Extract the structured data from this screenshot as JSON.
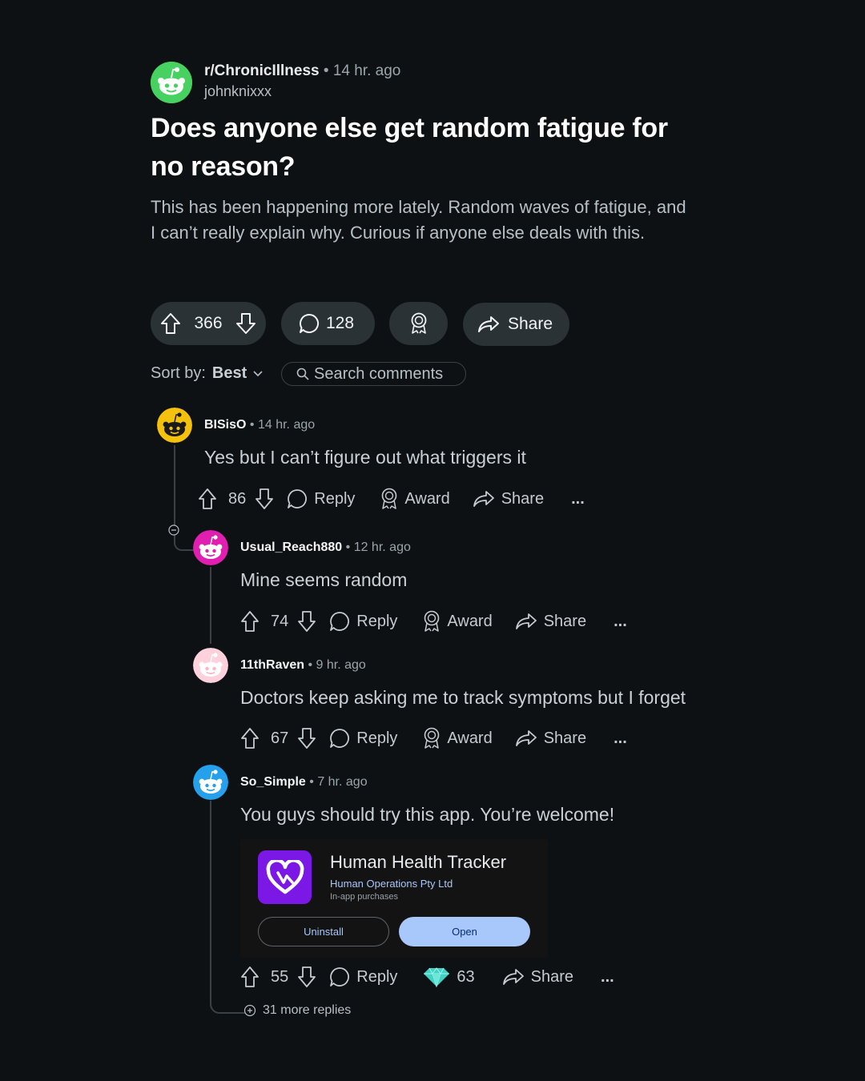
{
  "post": {
    "subreddit": "r/ChronicIllness",
    "separator": "•",
    "time": "14 hr. ago",
    "author": "johnknixxx",
    "title": "Does anyone else get random fatigue for no reason?",
    "body": "This has been happening more lately. Random waves of fatigue, and I can’t really explain why. Curious if anyone else deals with this.",
    "votes": "366",
    "comments": "128",
    "share_label": "Share"
  },
  "sort": {
    "label": "Sort by:",
    "value": "Best"
  },
  "search": {
    "placeholder": "Search comments"
  },
  "labels": {
    "reply": "Reply",
    "award": "Award",
    "share": "Share",
    "more": "..."
  },
  "comments": [
    {
      "username": "BISisO",
      "time": "• 14 hr. ago",
      "text": "Yes but I can’t figure out what triggers it",
      "votes": "86",
      "avatar_color": "#f4c10c"
    },
    {
      "username": "Usual_Reach880",
      "time": "• 12 hr. ago",
      "text": "Mine seems random",
      "votes": "74",
      "avatar_color": "#e01fb0"
    },
    {
      "username": "11thRaven",
      "time": "• 9 hr. ago",
      "text": "Doctors keep asking me to track symptoms but I forget",
      "votes": "67",
      "avatar_color": "#ffd1dc"
    },
    {
      "username": "So_Simple",
      "time": "• 7 hr. ago",
      "text": "You guys should try this app. You’re welcome!",
      "votes": "55",
      "gems": "63",
      "avatar_color": "#24a0ed"
    }
  ],
  "app_card": {
    "name": "Human Health Tracker",
    "developer": "Human Operations Pty Ltd",
    "note": "In-app purchases",
    "uninstall_label": "Uninstall",
    "open_label": "Open"
  },
  "more_replies": "31 more replies",
  "colors": {
    "background": "#0e1113",
    "pill": "#2a3236",
    "app_icon": "#7b18e6",
    "open_button": "#a8c7fa"
  }
}
